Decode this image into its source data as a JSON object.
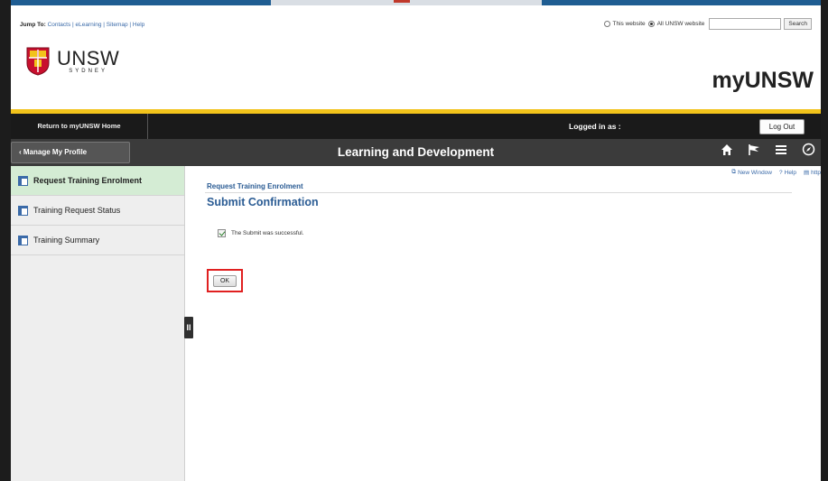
{
  "header": {
    "jump_to_label": "Jump To:",
    "jump_links": "Contacts | eLearning | Sitemap | Help",
    "search_scope_this": "This website",
    "search_scope_all": "All UNSW website",
    "search_selected": "All UNSW website",
    "search_value": "",
    "search_button": "Search",
    "logo_main": "UNSW",
    "logo_sub": "SYDNEY",
    "site_title": "myUNSW"
  },
  "topbar": {
    "return_home": "Return to myUNSW Home",
    "logged_in": "Logged in as :",
    "logout": "Log Out"
  },
  "navbar": {
    "back_label": "Manage My Profile",
    "title": "Learning and Development",
    "icons": [
      "home-icon",
      "flag-icon",
      "menu-icon",
      "compass-icon"
    ]
  },
  "sidebar": {
    "items": [
      {
        "label": "Request Training Enrolment",
        "active": true
      },
      {
        "label": "Training Request Status",
        "active": false
      },
      {
        "label": "Training Summary",
        "active": false
      }
    ]
  },
  "main": {
    "tools": {
      "new_window": "New Window",
      "help": "Help",
      "http": "http"
    },
    "breadcrumb": "Request Training Enrolment",
    "title": "Submit Confirmation",
    "message": "The Submit was successful.",
    "ok_button": "OK"
  },
  "colors": {
    "accent_yellow": "#f2c31b",
    "nav_dark": "#3b3b3b",
    "link_blue": "#2b5c94",
    "active_item": "#d4ecd4",
    "highlight_red": "#e02020"
  }
}
